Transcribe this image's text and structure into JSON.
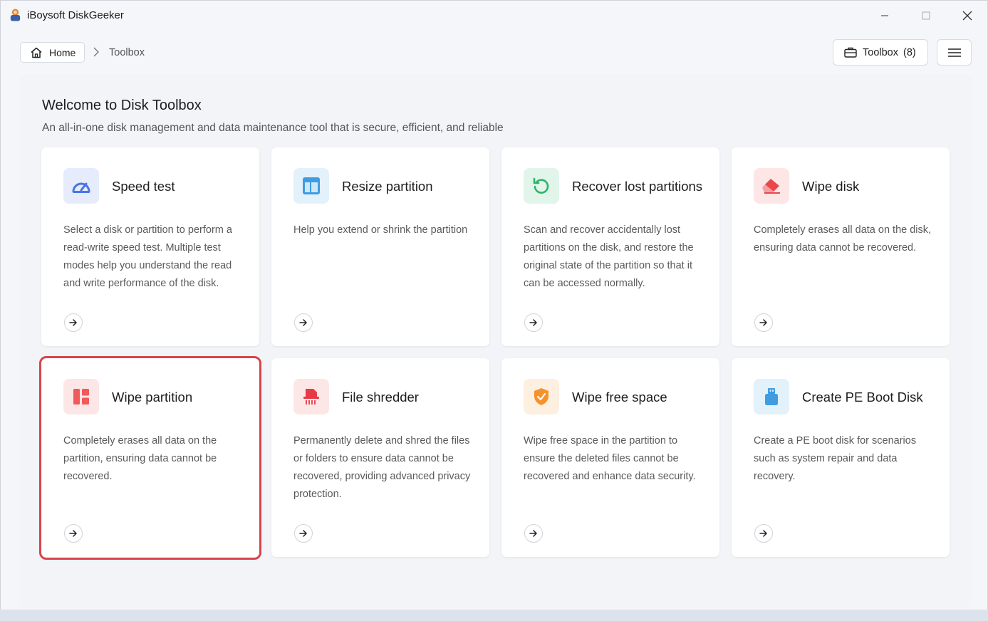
{
  "window": {
    "title": "iBoysoft DiskGeeker"
  },
  "breadcrumb": {
    "home_label": "Home",
    "current": "Toolbox"
  },
  "header": {
    "toolbox_label": "Toolbox",
    "toolbox_count": "(8)"
  },
  "panel": {
    "title": "Welcome to Disk Toolbox",
    "subtitle": "An all-in-one disk management and data maintenance tool that is secure, efficient, and reliable"
  },
  "cards": [
    {
      "title": "Speed test",
      "description": "Select a disk or partition to perform a read-write speed test. Multiple test modes help you understand the read and write performance of the disk.",
      "icon": "speedometer-icon",
      "icon_bg": "#e6ecfb",
      "icon_color": "#4a74e8"
    },
    {
      "title": "Resize partition",
      "description": "Help you extend or shrink the partition",
      "icon": "layout-icon",
      "icon_bg": "#e3f1fb",
      "icon_color": "#3f9ce0"
    },
    {
      "title": "Recover lost partitions",
      "description": "Scan and recover accidentally lost partitions on the disk, and restore the original state of the partition so that it can be accessed normally.",
      "icon": "restore-icon",
      "icon_bg": "#e2f5ea",
      "icon_color": "#2fb36b"
    },
    {
      "title": "Wipe disk",
      "description": "Completely erases all data on the disk, ensuring data cannot be recovered.",
      "icon": "eraser-icon",
      "icon_bg": "#fde6e6",
      "icon_color": "#e9474a"
    },
    {
      "title": "Wipe partition",
      "description": "Completely erases all data on the partition, ensuring data cannot be recovered.",
      "icon": "partition-icon",
      "icon_bg": "#fde6e6",
      "icon_color": "#ef5a5a"
    },
    {
      "title": "File shredder",
      "description": "Permanently delete and shred the files or folders to ensure data cannot be recovered, providing advanced privacy protection.",
      "icon": "shredder-icon",
      "icon_bg": "#fde6e6",
      "icon_color": "#e63a45"
    },
    {
      "title": "Wipe free space",
      "description": "Wipe free space in the partition to ensure the deleted files cannot be recovered and enhance data security.",
      "icon": "shield-icon",
      "icon_bg": "#fdf0e1",
      "icon_color": "#f5922b"
    },
    {
      "title": "Create PE Boot Disk",
      "description": "Create a PE boot disk for scenarios such as system repair and data recovery.",
      "icon": "usb-drive-icon",
      "icon_bg": "#e3f1fb",
      "icon_color": "#3f9ce0"
    }
  ],
  "selected_card": "Wipe partition",
  "colors": {
    "selection_outline": "#d9434a"
  }
}
